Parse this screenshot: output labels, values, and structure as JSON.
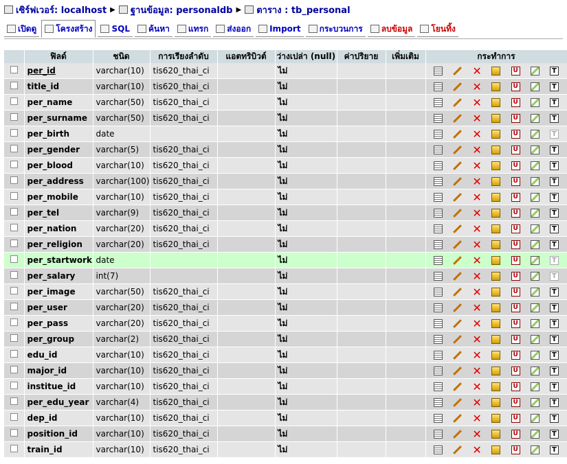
{
  "breadcrumb": {
    "server_label": "เซิร์ฟเวอร์: localhost",
    "database_label": "ฐานข้อมูล: personaldb",
    "table_label": "ตาราง : tb_personal"
  },
  "tabs": [
    {
      "label": "เปิดดู",
      "icon": "browse-icon"
    },
    {
      "label": "โครงสร้าง",
      "icon": "structure-icon",
      "active": true
    },
    {
      "label": "SQL",
      "icon": "sql-icon"
    },
    {
      "label": "ค้นหา",
      "icon": "search-icon"
    },
    {
      "label": "แทรก",
      "icon": "insert-icon"
    },
    {
      "label": "ส่งออก",
      "icon": "export-icon"
    },
    {
      "label": "Import",
      "icon": "import-icon"
    },
    {
      "label": "กระบวนการ",
      "icon": "operations-icon"
    },
    {
      "label": "ลบข้อมูล",
      "icon": "empty-icon",
      "danger": true
    },
    {
      "label": "โยนทิ้ง",
      "icon": "drop-icon",
      "danger": true
    }
  ],
  "columns": {
    "field": "ฟิลด์",
    "type": "ชนิด",
    "collation": "การเรียงลำดับ",
    "attributes": "แอตทริบิวต์",
    "null": "ว่างเปล่า (null)",
    "default": "ค่าปริยาย",
    "extra": "เพิ่มเติม",
    "action": "กระทำการ"
  },
  "rows": [
    {
      "field": "per_id",
      "type": "varchar(10)",
      "collation": "tis620_thai_ci",
      "null": "ไม่",
      "primary": true
    },
    {
      "field": "title_id",
      "type": "varchar(10)",
      "collation": "tis620_thai_ci",
      "null": "ไม่"
    },
    {
      "field": "per_name",
      "type": "varchar(50)",
      "collation": "tis620_thai_ci",
      "null": "ไม่"
    },
    {
      "field": "per_surname",
      "type": "varchar(50)",
      "collation": "tis620_thai_ci",
      "null": "ไม่"
    },
    {
      "field": "per_birth",
      "type": "date",
      "collation": "",
      "null": "ไม่",
      "fulltext_disabled": true
    },
    {
      "field": "per_gender",
      "type": "varchar(5)",
      "collation": "tis620_thai_ci",
      "null": "ไม่"
    },
    {
      "field": "per_blood",
      "type": "varchar(10)",
      "collation": "tis620_thai_ci",
      "null": "ไม่"
    },
    {
      "field": "per_address",
      "type": "varchar(100)",
      "collation": "tis620_thai_ci",
      "null": "ไม่"
    },
    {
      "field": "per_mobile",
      "type": "varchar(10)",
      "collation": "tis620_thai_ci",
      "null": "ไม่"
    },
    {
      "field": "per_tel",
      "type": "varchar(9)",
      "collation": "tis620_thai_ci",
      "null": "ไม่"
    },
    {
      "field": "per_nation",
      "type": "varchar(20)",
      "collation": "tis620_thai_ci",
      "null": "ไม่"
    },
    {
      "field": "per_religion",
      "type": "varchar(20)",
      "collation": "tis620_thai_ci",
      "null": "ไม่"
    },
    {
      "field": "per_startwork",
      "type": "date",
      "collation": "",
      "null": "ไม่",
      "highlight": true,
      "fulltext_disabled": true
    },
    {
      "field": "per_salary",
      "type": "int(7)",
      "collation": "",
      "null": "ไม่",
      "fulltext_disabled": true
    },
    {
      "field": "per_image",
      "type": "varchar(50)",
      "collation": "tis620_thai_ci",
      "null": "ไม่"
    },
    {
      "field": "per_user",
      "type": "varchar(20)",
      "collation": "tis620_thai_ci",
      "null": "ไม่"
    },
    {
      "field": "per_pass",
      "type": "varchar(20)",
      "collation": "tis620_thai_ci",
      "null": "ไม่"
    },
    {
      "field": "per_group",
      "type": "varchar(2)",
      "collation": "tis620_thai_ci",
      "null": "ไม่"
    },
    {
      "field": "edu_id",
      "type": "varchar(10)",
      "collation": "tis620_thai_ci",
      "null": "ไม่"
    },
    {
      "field": "major_id",
      "type": "varchar(10)",
      "collation": "tis620_thai_ci",
      "null": "ไม่"
    },
    {
      "field": "institue_id",
      "type": "varchar(10)",
      "collation": "tis620_thai_ci",
      "null": "ไม่"
    },
    {
      "field": "per_edu_year",
      "type": "varchar(4)",
      "collation": "tis620_thai_ci",
      "null": "ไม่"
    },
    {
      "field": "dep_id",
      "type": "varchar(10)",
      "collation": "tis620_thai_ci",
      "null": "ไม่"
    },
    {
      "field": "position_id",
      "type": "varchar(10)",
      "collation": "tis620_thai_ci",
      "null": "ไม่"
    },
    {
      "field": "train_id",
      "type": "varchar(10)",
      "collation": "tis620_thai_ci",
      "null": "ไม่"
    }
  ],
  "action_icons": [
    "browse-icon",
    "edit-icon",
    "drop-icon",
    "primary-icon",
    "unique-icon",
    "index-icon",
    "fulltext-icon"
  ],
  "colors": {
    "header_bg": "#d0dce0",
    "row_odd": "#e5e5e5",
    "row_even": "#d5d5d5",
    "row_highlight": "#ccffcc",
    "link": "#0000c0",
    "danger": "#cc0000"
  }
}
